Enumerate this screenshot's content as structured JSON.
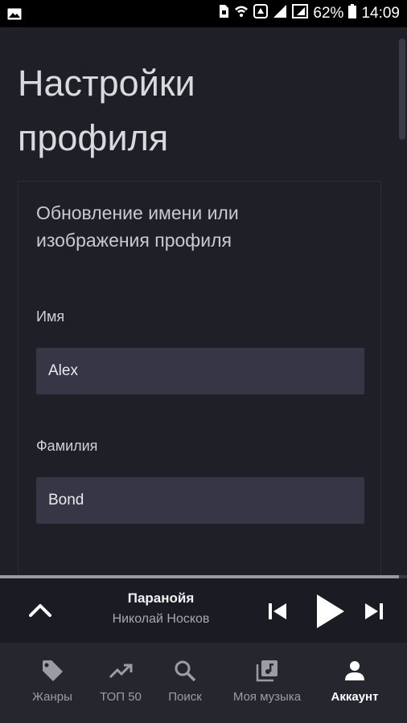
{
  "status_bar": {
    "battery_percent": "62%",
    "time": "14:09",
    "icons": [
      "gallery-icon",
      "sim-icon",
      "wifi-icon",
      "data-icon",
      "signal-icon",
      "signal-icon-2",
      "battery-icon"
    ]
  },
  "page": {
    "title_line1": "Настройки",
    "title_line2": "профиля"
  },
  "card": {
    "heading_line1": "Обновление имени или",
    "heading_line2": "изображения профиля",
    "first_name_label": "Имя",
    "first_name_value": "Alex",
    "last_name_label": "Фамилия",
    "last_name_value": "Bond"
  },
  "player": {
    "title": "Паранойя",
    "artist": "Николай Носков",
    "progress": 0.98
  },
  "nav": {
    "genres": "Жанры",
    "top50": "ТОП 50",
    "search": "Поиск",
    "my_music": "Моя музыка",
    "account": "Аккаунт",
    "active": "account"
  },
  "colors": {
    "background": "#1f2027",
    "input_bg": "#363646",
    "nav_bg": "#26262e",
    "active_nav": "#ffffff",
    "inactive_nav": "#9c9ca6"
  }
}
